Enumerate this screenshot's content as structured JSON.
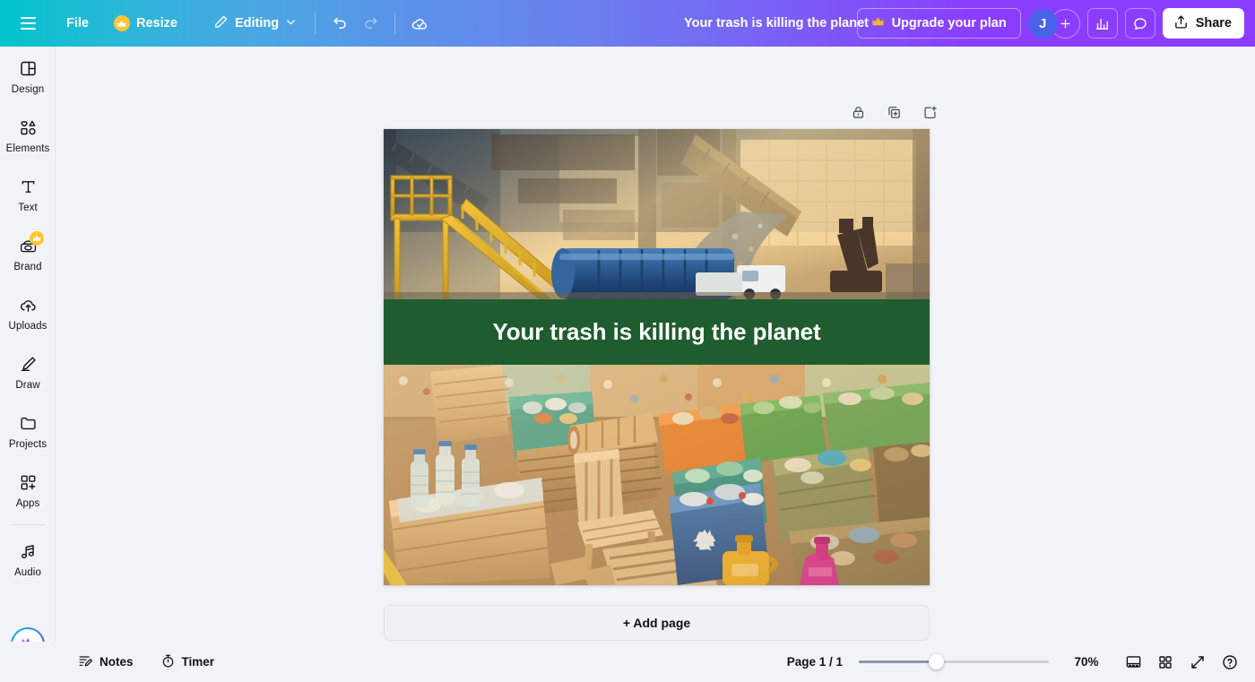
{
  "header": {
    "menu_icon": "hamburger-icon",
    "file_label": "File",
    "resize_label": "Resize",
    "resize_badge": "crown-icon",
    "editing_label": "Editing",
    "editing_chevron": "chevron-down-icon",
    "undo_icon": "undo-icon",
    "redo_icon": "redo-icon",
    "cloud_icon": "cloud-saved-icon",
    "doc_title": "Your trash is killing the planet",
    "upgrade_label": "Upgrade your plan",
    "upgrade_icon": "crown-icon",
    "avatar_initial": "J",
    "avatar_color": "#4a62e8",
    "add_collaborator_icon": "plus-icon",
    "insights_icon": "bar-chart-icon",
    "comments_icon": "comment-bubble-icon",
    "share_label": "Share",
    "share_icon": "share-upload-icon"
  },
  "sidebar": {
    "items": [
      {
        "label": "Design",
        "icon": "design-panel-icon",
        "badge": null
      },
      {
        "label": "Elements",
        "icon": "elements-shapes-icon",
        "badge": null
      },
      {
        "label": "Text",
        "icon": "text-t-icon",
        "badge": null
      },
      {
        "label": "Brand",
        "icon": "brand-kit-icon",
        "badge": "crown-icon"
      },
      {
        "label": "Uploads",
        "icon": "upload-cloud-icon",
        "badge": null
      },
      {
        "label": "Draw",
        "icon": "draw-pen-icon",
        "badge": null
      },
      {
        "label": "Projects",
        "icon": "folder-icon",
        "badge": null
      },
      {
        "label": "Apps",
        "icon": "apps-grid-plus-icon",
        "badge": null
      },
      {
        "label": "Audio",
        "icon": "audio-note-icon",
        "badge": null
      }
    ],
    "ai_assistant_icon": "magic-sparkle-icon"
  },
  "page_tools": [
    {
      "name": "lock-page-button",
      "icon": "lock-icon"
    },
    {
      "name": "duplicate-page-button",
      "icon": "duplicate-icon"
    },
    {
      "name": "add-page-button",
      "icon": "add-page-icon"
    }
  ],
  "canvas": {
    "banner_text": "Your trash is killing the planet",
    "banner_color": "#1f5c2f",
    "top_image_alt": "Industrial waste recycling plant interior with yellow staircase, blue tank and conveyor",
    "bottom_image_alt": "Sorted recycling crates of plastic bottles, wood and mixed waste",
    "add_page_label": "+ Add page"
  },
  "footer": {
    "notes_label": "Notes",
    "notes_icon": "notes-icon",
    "timer_label": "Timer",
    "timer_icon": "timer-icon",
    "page_count": "Page 1 / 1",
    "zoom_level": "70%",
    "view_grid_icon": "page-view-icon",
    "grid_view_icon": "grid-view-icon",
    "fullscreen_icon": "expand-icon",
    "help_icon": "help-circle-icon"
  }
}
